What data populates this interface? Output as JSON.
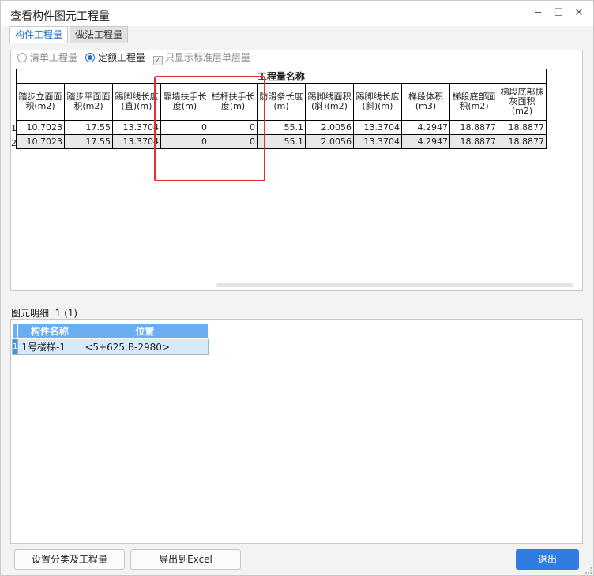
{
  "window": {
    "title": "查看构件图元工程量"
  },
  "tabs": [
    "构件工程量",
    "做法工程量"
  ],
  "options": {
    "radio_list": "清单工程量",
    "radio_quota": "定额工程量",
    "checkbox_std": "只显示标准层单层量"
  },
  "table": {
    "group_header": "工程量名称",
    "columns": [
      "踏步立面面积(m2)",
      "踏步平面面积(m2)",
      "踢脚线长度(直)(m)",
      "靠墙扶手长度(m)",
      "栏杆扶手长度(m)",
      "防滑条长度(m)",
      "踢脚线面积(斜)(m2)",
      "踢脚线长度(斜)(m)",
      "梯段体积(m3)",
      "梯段底部面积(m2)",
      "梯段底部抹灰面积(m2)"
    ],
    "rows": [
      {
        "num": "1",
        "cells": [
          "10.7023",
          "17.55",
          "13.3704",
          "0",
          "0",
          "55.1",
          "2.0056",
          "13.3704",
          "4.2947",
          "18.8877",
          "18.8877"
        ]
      },
      {
        "num": "2",
        "cells": [
          "10.7023",
          "17.55",
          "13.3704",
          "0",
          "0",
          "55.1",
          "2.0056",
          "13.3704",
          "4.2947",
          "18.8877",
          "18.8877"
        ]
      }
    ]
  },
  "detail": {
    "label": "图元明细",
    "count": "1 (1)",
    "columns": [
      "构件名称",
      "位置"
    ],
    "rows": [
      {
        "num": "1",
        "name": "1号楼梯-1",
        "position": "<5+625,B-2980>"
      }
    ]
  },
  "buttons": {
    "setup": "设置分类及工程量",
    "export": "导出到Excel",
    "exit": "退出"
  },
  "colors": {
    "accent": "#2f7de1",
    "highlight": "#e03030",
    "header_blue": "#6aaef0"
  }
}
